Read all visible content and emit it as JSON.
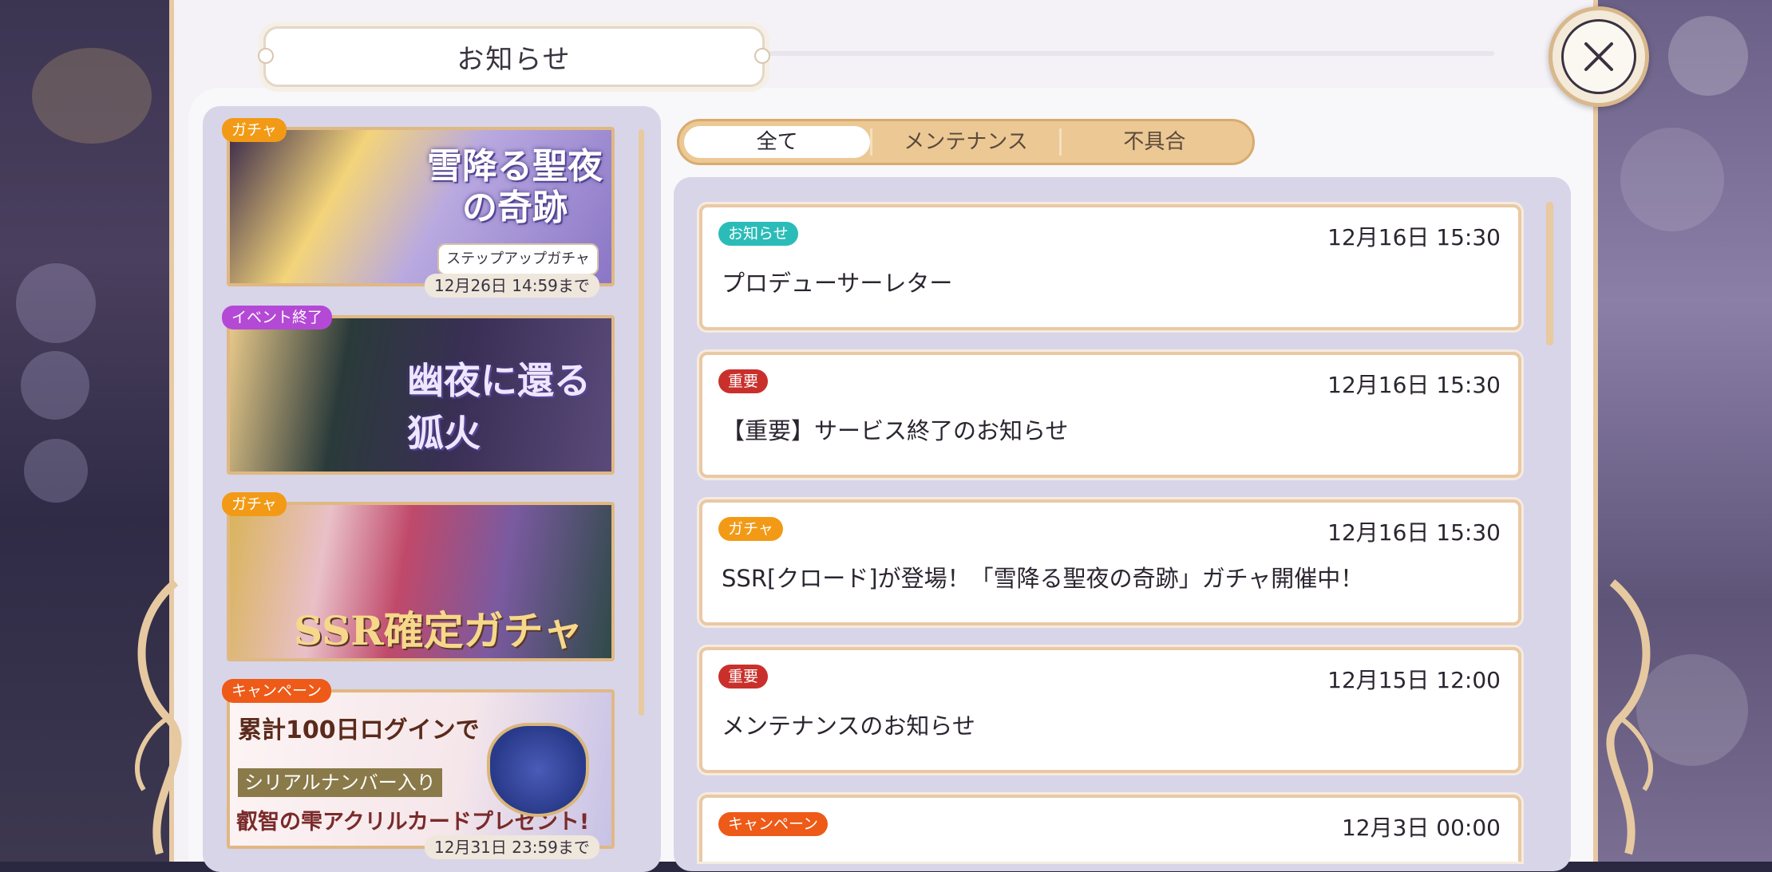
{
  "header": {
    "title": "お知らせ"
  },
  "tabs": [
    {
      "label": "全て",
      "active": true
    },
    {
      "label": "メンテナンス",
      "active": false
    },
    {
      "label": "不具合",
      "active": false
    }
  ],
  "banners": [
    {
      "tag": "ガチャ",
      "title": "雪降る聖夜の奇跡",
      "subtitle": "ステップアップガチャ",
      "date": "12月26日 14:59まで"
    },
    {
      "tag": "イベント終了",
      "title": "幽夜に還る狐火"
    },
    {
      "tag": "ガチャ",
      "title": "SSR確定ガチャ"
    },
    {
      "tag": "キャンペーン",
      "line1": "累計100日ログインで",
      "line2": "シリアルナンバー入り",
      "line3": "叡智の雫アクリルカードプレゼント!",
      "date": "12月31日 23:59まで"
    }
  ],
  "news": [
    {
      "badge": "お知らせ",
      "date": "12月16日 15:30",
      "title": "プロデューサーレター"
    },
    {
      "badge": "重要",
      "date": "12月16日 15:30",
      "title": "【重要】サービス終了のお知らせ"
    },
    {
      "badge": "ガチャ",
      "date": "12月16日 15:30",
      "title": "SSR[クロード]が登場！「雪降る聖夜の奇跡」ガチャ開催中！"
    },
    {
      "badge": "重要",
      "date": "12月15日 12:00",
      "title": "メンテナンスのお知らせ"
    },
    {
      "badge": "キャンペーン",
      "date": "12月3日 00:00",
      "title": ""
    }
  ],
  "icons": {
    "close": "close-icon"
  },
  "colors": {
    "accent": "#e8c9a0",
    "panel": "#d8d5e8",
    "important": "#c9302c",
    "info": "#2bbcb8",
    "gacha": "#f29a16"
  }
}
